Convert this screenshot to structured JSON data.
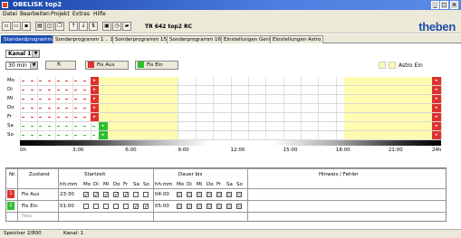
{
  "window": {
    "title": "OBELISK top2"
  },
  "menu": [
    "Datei",
    "Bearbeiten",
    "Projekt",
    "Extras",
    "Hilfe"
  ],
  "toolbar": {
    "device": "TR 642 top2 RC"
  },
  "brand": {
    "logo": "theben"
  },
  "tabs": [
    "Standardprogramm",
    "Sonderprogramm 1 .. 14",
    "Sonderprogramm 15",
    "Sonderprogramm 16",
    "Einstellungen Gerät",
    "Einstellungen Astro"
  ],
  "controls": {
    "kanal": "Kanal 1",
    "interval": "30 min",
    "fix_aus": "Fix Aus",
    "fix_ein": "Fix Ein",
    "astro_ein": "Astro Ein"
  },
  "days": [
    "Mo",
    "Di",
    "Mi",
    "Do",
    "Fr",
    "Sa",
    "So"
  ],
  "time_axis": [
    "0h",
    "3:00",
    "6:00",
    "9:00",
    "12:00",
    "15:00",
    "18:00",
    "21:00",
    "24h"
  ],
  "colors": {
    "fix_aus": "#e03030",
    "fix_ein": "#2cc02c",
    "astro": "#fffbb0",
    "accent": "#1f51b5"
  },
  "table": {
    "headers": {
      "nr": "Nr.",
      "zustand": "Zustand",
      "startzeit": "Startzeit",
      "dauer": "Dauer bis",
      "hinweis": "Hinweis / Fehler",
      "hhmm": "hh:mm",
      "days": [
        "Mo",
        "Di",
        "Mi",
        "Do",
        "Fr",
        "Sa",
        "So"
      ]
    },
    "rows": [
      {
        "nr": "1",
        "zustand": "Fix Aus",
        "start": "23:30",
        "start_days": [
          true,
          true,
          true,
          true,
          true,
          false,
          false
        ],
        "dauer": "04:00",
        "dauer_days": [
          false,
          false,
          false,
          false,
          false,
          false,
          false
        ]
      },
      {
        "nr": "2",
        "zustand": "Fix Ein",
        "start": "01:00",
        "start_days": [
          false,
          false,
          false,
          false,
          false,
          true,
          true
        ],
        "dauer": "05:00",
        "dauer_days": [
          false,
          false,
          false,
          false,
          false,
          false,
          false
        ]
      }
    ],
    "new_row": "Neu"
  },
  "status": {
    "speicher": "Speicher 2/800",
    "kanal": "Kanal: 1"
  }
}
